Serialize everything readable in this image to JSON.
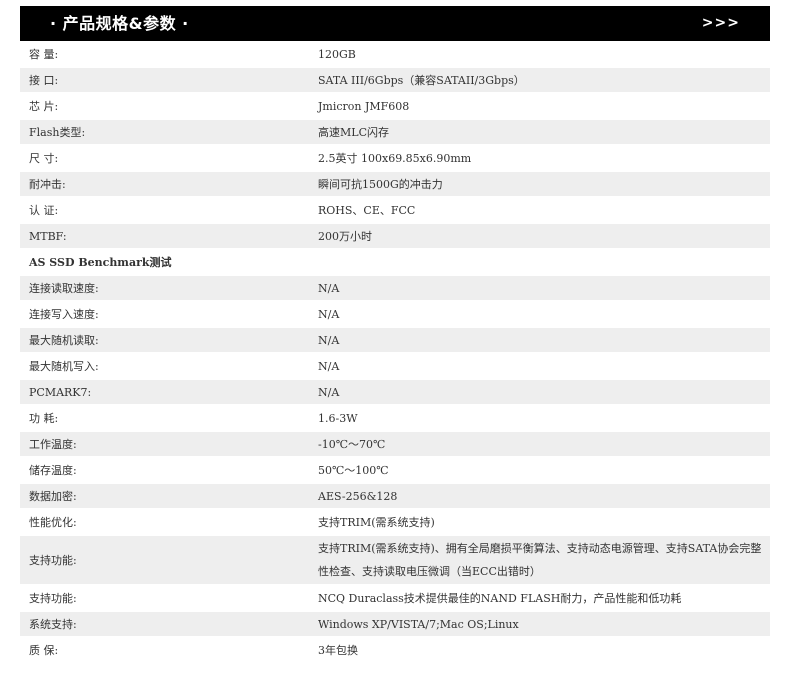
{
  "header": {
    "title": "· 产品规格&参数 ·",
    "more": ">>>"
  },
  "rows": [
    {
      "label": "容 量:",
      "value": "120GB"
    },
    {
      "label": "接 口:",
      "value": "SATA III/6Gbps（兼容SATAII/3Gbps）"
    },
    {
      "label": "芯 片:",
      "value": "Jmicron JMF608"
    },
    {
      "label": "Flash类型:",
      "value": "高速MLC闪存"
    },
    {
      "label": "尺 寸:",
      "value": "2.5英寸 100x69.85x6.90mm"
    },
    {
      "label": "耐冲击:",
      "value": "瞬间可抗1500G的冲击力"
    },
    {
      "label": "认 证:",
      "value": "ROHS、CE、FCC"
    },
    {
      "label": "MTBF:",
      "value": "200万小时"
    },
    {
      "label": "AS SSD Benchmark测试",
      "value": ""
    },
    {
      "label": "连接读取速度:",
      "value": "N/A"
    },
    {
      "label": "连接写入速度:",
      "value": "N/A"
    },
    {
      "label": "最大随机读取:",
      "value": "N/A"
    },
    {
      "label": "最大随机写入:",
      "value": "N/A"
    },
    {
      "label": "PCMARK7:",
      "value": "N/A"
    },
    {
      "label": "功 耗:",
      "value": "1.6-3W"
    },
    {
      "label": "工作温度:",
      "value": "-10℃～70℃"
    },
    {
      "label": "储存温度:",
      "value": "50℃～100℃"
    },
    {
      "label": "数据加密:",
      "value": "AES-256&128"
    },
    {
      "label": "性能优化:",
      "value": "支持TRIM(需系统支持)"
    },
    {
      "label": "支持功能:",
      "value": "支持TRIM(需系统支持)、拥有全局磨损平衡算法、支持动态电源管理、支持SATA协会完整性检查、支持读取电压微调（当ECC出错时）"
    },
    {
      "label": "支持功能:",
      "value": "NCQ Duraclass技术提供最佳的NAND FLASH耐力，产品性能和低功耗"
    },
    {
      "label": "系统支持:",
      "value": "Windows XP/VISTA/7;Mac OS;Linux"
    },
    {
      "label": "质 保:",
      "value": "3年包换"
    }
  ]
}
